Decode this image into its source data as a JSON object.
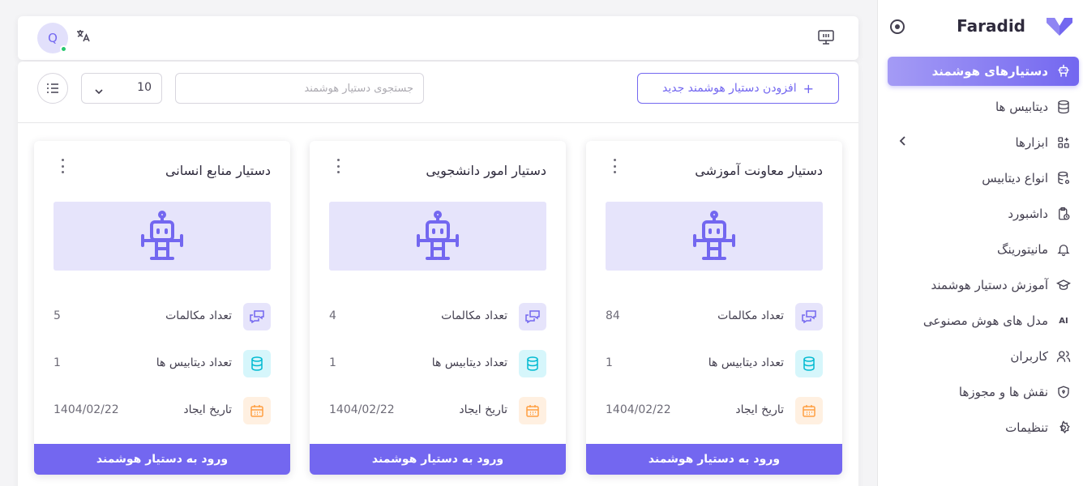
{
  "brand": {
    "name": "Faradid",
    "logo_color": "#7367f0"
  },
  "sidebar": {
    "items": [
      {
        "label": "دستیارهای هوشمند",
        "icon": "robot-icon",
        "active": true
      },
      {
        "label": "دیتابیس ها",
        "icon": "database-icon"
      },
      {
        "label": "ابزارها",
        "icon": "apps-icon",
        "has_submenu": true
      },
      {
        "label": "انواع دیتابیس",
        "icon": "database-cog-icon"
      },
      {
        "label": "داشبورد",
        "icon": "clipboard-clock-icon"
      },
      {
        "label": "مانیتورینگ",
        "icon": "bell-icon"
      },
      {
        "label": "آموزش دستیار هوشمند",
        "icon": "graduation-cap-icon"
      },
      {
        "label": "مدل های هوش مصنوعی",
        "icon": "ai-icon"
      },
      {
        "label": "کاربران",
        "icon": "users-icon"
      },
      {
        "label": "نقش ها و مجوزها",
        "icon": "shield-icon"
      },
      {
        "label": "تنظیمات",
        "icon": "gear-icon"
      }
    ]
  },
  "topbar": {
    "avatar_initial": "Q",
    "avatar_status": "online"
  },
  "toolbar": {
    "add_button_label": "افزودن دستیار هوشمند جدید",
    "search_placeholder": "جستجوی دستیار هوشمند",
    "page_size": "10"
  },
  "cards": [
    {
      "title": "دستیار معاونت آموزشی",
      "stats": [
        {
          "label": "تعداد مکالمات",
          "value": "84"
        },
        {
          "label": "تعداد دیتابیس ها",
          "value": "1"
        },
        {
          "label": "تاریخ ایجاد",
          "value": "1404/02/22"
        }
      ],
      "button_label": "ورود به دستیار هوشمند"
    },
    {
      "title": "دستیار امور دانشجویی",
      "stats": [
        {
          "label": "تعداد مکالمات",
          "value": "4"
        },
        {
          "label": "تعداد دیتابیس ها",
          "value": "1"
        },
        {
          "label": "تاریخ ایجاد",
          "value": "1404/02/22"
        }
      ],
      "button_label": "ورود به دستیار هوشمند"
    },
    {
      "title": "دستیار منابع انسانی",
      "stats": [
        {
          "label": "تعداد مکالمات",
          "value": "5"
        },
        {
          "label": "تعداد دیتابیس ها",
          "value": "1"
        },
        {
          "label": "تاریخ ایجاد",
          "value": "1404/02/22"
        }
      ],
      "button_label": "ورود به دستیار هوشمند"
    }
  ],
  "colors": {
    "primary": "#7367f0",
    "cyan": "#00bad1",
    "orange": "#ff9f43",
    "online": "#28c76f"
  }
}
